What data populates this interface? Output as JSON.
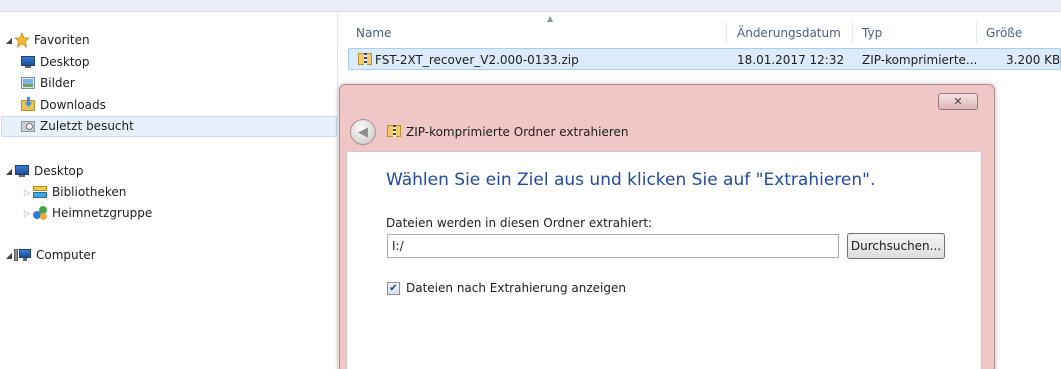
{
  "navigation": {
    "items": [
      {
        "label": "Favoriten"
      },
      {
        "label": "Desktop"
      },
      {
        "label": "Bilder"
      },
      {
        "label": "Downloads"
      },
      {
        "label": "Zuletzt besucht"
      },
      {
        "label": "Desktop"
      },
      {
        "label": "Bibliotheken"
      },
      {
        "label": "Heimnetzgruppe"
      },
      {
        "label": "Computer"
      }
    ]
  },
  "file_list": {
    "columns": [
      "Name",
      "Änderungsdatum",
      "Typ",
      "Größe"
    ],
    "rows": [
      {
        "name": "FST-2XT_recover_V2.000-0133.zip",
        "date": "18.01.2017 12:32",
        "type": "ZIP-komprimierte...",
        "size": "3.200 KB"
      }
    ]
  },
  "dialog": {
    "title": "ZIP-komprimierte Ordner extrahieren",
    "close_glyph": "✕",
    "back_glyph": "◀",
    "instruction": "Wählen Sie ein Ziel aus und klicken Sie auf \"Extrahieren\".",
    "destination_label": "Dateien werden in diesen Ordner extrahiert:",
    "destination_value": "I:/",
    "browse_label": "Durchsuchen...",
    "show_files_label": "Dateien nach Extrahierung anzeigen",
    "show_files_checked": true
  },
  "colors": {
    "dialog_frame": "#f0c6c6",
    "instruction_text": "#1f4aa5",
    "selection": "#dcebfc"
  }
}
